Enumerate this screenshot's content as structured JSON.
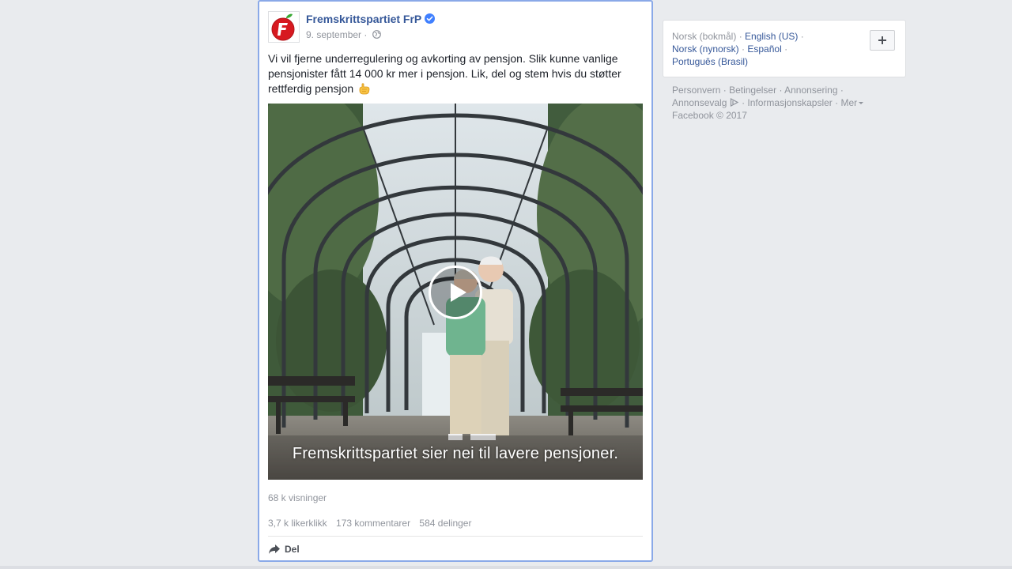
{
  "post": {
    "page_name": "Fremskrittspartiet FrP",
    "date": "9. september",
    "separator": "·",
    "text": "Vi vil fjerne underregulering og avkorting av pensjon. Slik kunne vanlige pensjonister fått 14 000 kr mer i pensjon. Lik, del og stem hvis du støtter rettferdig pensjon",
    "video": {
      "subtitle": "Fremskrittspartiet sier nei til lavere pensjoner."
    },
    "views": "68 k visninger",
    "likes": "3,7 k likerklikk",
    "comments": "173 kommentarer",
    "shares": "584 delinger",
    "share_label": "Del"
  },
  "languages": {
    "current": "Norsk (bokmål)",
    "english": "English (US)",
    "nynorsk": "Norsk (nynorsk)",
    "spanish": "Español",
    "portuguese": "Português (Brasil)",
    "sep": "·"
  },
  "footer": {
    "privacy": "Personvern",
    "terms": "Betingelser",
    "advertising": "Annonsering",
    "ad_choices": "Annonsevalg",
    "cookies": "Informasjonskapsler",
    "more": "Mer",
    "copyright": "Facebook © 2017",
    "sep": "·"
  },
  "colors": {
    "link": "#365899",
    "muted": "#90949c",
    "page_bg": "#e9ebee",
    "focus_border": "#8aa9e8",
    "verified": "#4080ff"
  },
  "icons": {
    "avatar": "frp-logo-icon",
    "verified": "verified-badge-icon",
    "audience": "globe-icon",
    "emoji": "pointing-hand-emoji-icon",
    "play": "play-icon",
    "share": "share-arrow-icon",
    "add_language": "plus-icon",
    "ad_choices": "ad-choices-icon"
  }
}
